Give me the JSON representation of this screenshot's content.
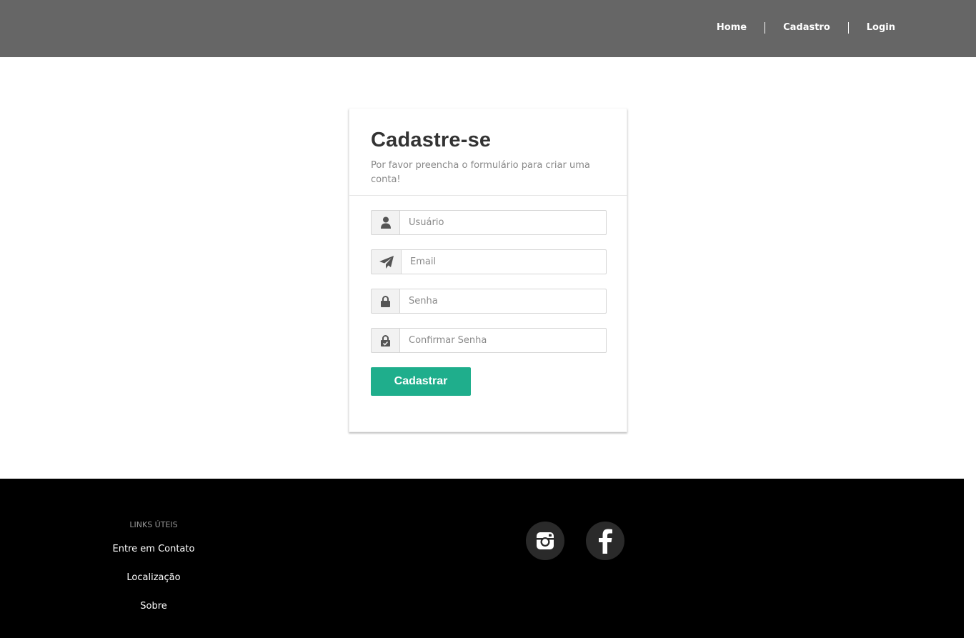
{
  "nav": {
    "items": [
      {
        "label": "Home"
      },
      {
        "label": "Cadastro"
      },
      {
        "label": "Login"
      }
    ]
  },
  "form": {
    "title": "Cadastre-se",
    "subtitle": "Por favor preencha o formulário para criar uma conta!",
    "username_placeholder": "Usuário",
    "email_placeholder": "Email",
    "password_placeholder": "Senha",
    "confirm_placeholder": "Confirmar Senha",
    "submit_label": "Cadastrar",
    "accent_color": "#1fae8c"
  },
  "footer": {
    "links_heading": "LINKS ÚTEIS",
    "links": [
      {
        "label": "Entre em Contato"
      },
      {
        "label": "Localização"
      },
      {
        "label": "Sobre"
      }
    ],
    "social": [
      {
        "icon": "instagram-icon"
      },
      {
        "icon": "facebook-icon"
      }
    ]
  }
}
